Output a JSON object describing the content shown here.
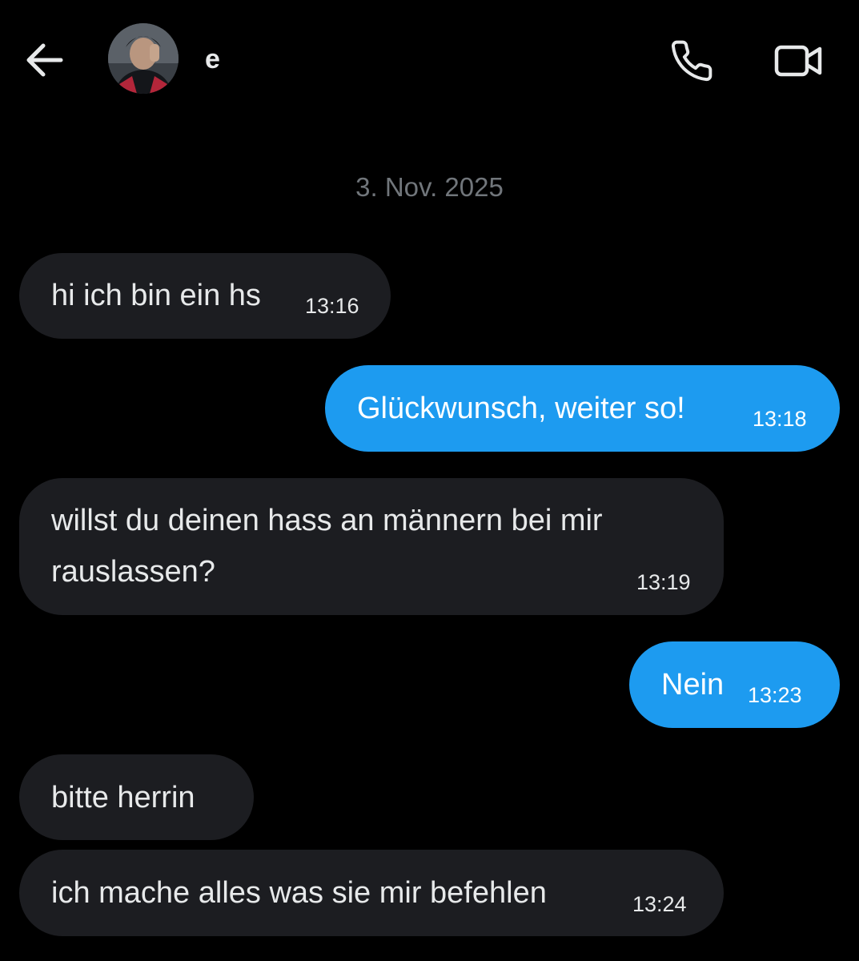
{
  "header": {
    "contact_name": "e",
    "back_icon": "arrow-left-icon",
    "call_icon": "phone-icon",
    "video_icon": "video-camera-icon"
  },
  "conversation": {
    "date_separator": "3. Nov. 2025",
    "messages": [
      {
        "direction": "incoming",
        "text": "hi ich bin ein hs",
        "time": "13:16"
      },
      {
        "direction": "outgoing",
        "text": "Glückwunsch, weiter so!",
        "time": "13:18"
      },
      {
        "direction": "incoming",
        "text_line1": "willst du deinen hass an männern bei mir",
        "text_line2": "rauslassen?",
        "time": "13:19"
      },
      {
        "direction": "outgoing",
        "text": "Nein",
        "time": "13:23"
      },
      {
        "direction": "incoming",
        "text": "bitte herrin",
        "time": ""
      },
      {
        "direction": "incoming",
        "text": "ich mache alles was sie mir befehlen",
        "time": "13:24"
      }
    ]
  },
  "colors": {
    "background": "#000000",
    "incoming_bubble": "#1c1d21",
    "outgoing_bubble": "#1d9bf0",
    "text_primary": "#e7e9ea",
    "text_secondary": "#71767b"
  }
}
